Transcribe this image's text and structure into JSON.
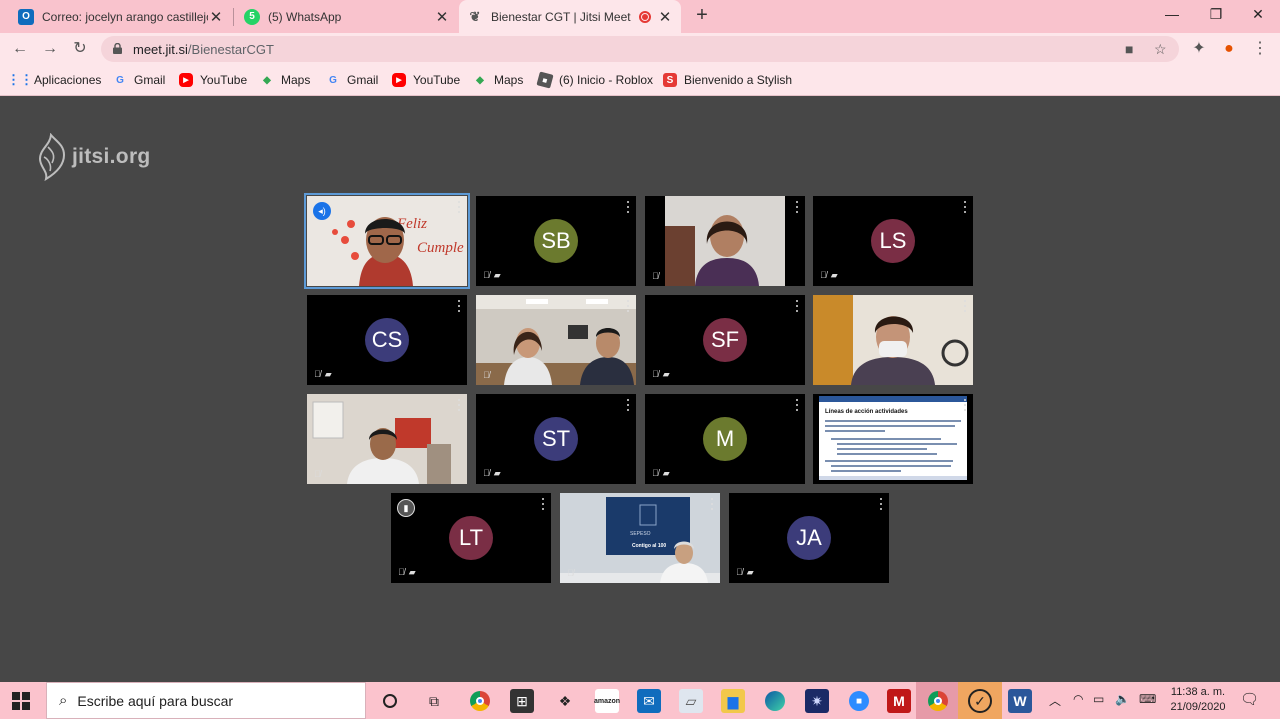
{
  "tabs": [
    {
      "title": "Correo: jocelyn arango castillejos",
      "icon": "outlook-icon",
      "color": "#0f6cbd"
    },
    {
      "title": "(5) WhatsApp",
      "icon": "whatsapp-icon",
      "color": "#25d366"
    },
    {
      "title": "Bienestar CGT | Jitsi Meet",
      "icon": "jitsi-icon",
      "color": "#555555"
    }
  ],
  "address": {
    "host": "meet.jit.si",
    "path": "/BienestarCGT"
  },
  "bookmarks": [
    {
      "label": "Aplicaciones",
      "icon": "apps-grid-icon"
    },
    {
      "label": "Gmail",
      "icon": "google-icon"
    },
    {
      "label": "YouTube",
      "icon": "youtube-icon"
    },
    {
      "label": "Maps",
      "icon": "maps-icon"
    },
    {
      "label": "Gmail",
      "icon": "google-icon"
    },
    {
      "label": "YouTube",
      "icon": "youtube-icon"
    },
    {
      "label": "Maps",
      "icon": "maps-icon"
    },
    {
      "label": "(6) Inicio - Roblox",
      "icon": "roblox-icon"
    },
    {
      "label": "Bienvenido a Stylish",
      "icon": "stylish-icon"
    }
  ],
  "jitsi": {
    "logo_text": "jitsi.org",
    "participants": [
      {
        "initials": "",
        "video": true,
        "scene": "woman-glasses-banner",
        "speaking": true,
        "text": [
          "Feliz",
          "Cumple"
        ]
      },
      {
        "initials": "SB",
        "video": false,
        "color": "#6b7a2e"
      },
      {
        "initials": "",
        "video": true,
        "scene": "woman-office"
      },
      {
        "initials": "LS",
        "video": false,
        "color": "#7a2e45"
      },
      {
        "initials": "CS",
        "video": false,
        "color": "#3c3c7a"
      },
      {
        "initials": "",
        "video": true,
        "scene": "two-people-office"
      },
      {
        "initials": "SF",
        "video": false,
        "color": "#7a2e45"
      },
      {
        "initials": "",
        "video": true,
        "scene": "woman-mask"
      },
      {
        "initials": "",
        "video": true,
        "scene": "man-red-wall"
      },
      {
        "initials": "ST",
        "video": false,
        "color": "#3c3c7a"
      },
      {
        "initials": "M",
        "video": false,
        "color": "#6b7a2e"
      },
      {
        "initials": "",
        "video": true,
        "scene": "shared-document",
        "text": [
          "Líneas de acción actividades"
        ]
      },
      {
        "initials": "LT",
        "video": false,
        "color": "#7a2e45",
        "indicator": "connection"
      },
      {
        "initials": "",
        "video": true,
        "scene": "man-banner",
        "text": [
          "SEPESO",
          "Contigo al 100"
        ]
      },
      {
        "initials": "JA",
        "video": false,
        "color": "#3c3c7a"
      }
    ]
  },
  "taskbar": {
    "search_placeholder": "Escribe aquí para buscar",
    "time": "11:38 a. m.",
    "date": "21/09/2020"
  }
}
